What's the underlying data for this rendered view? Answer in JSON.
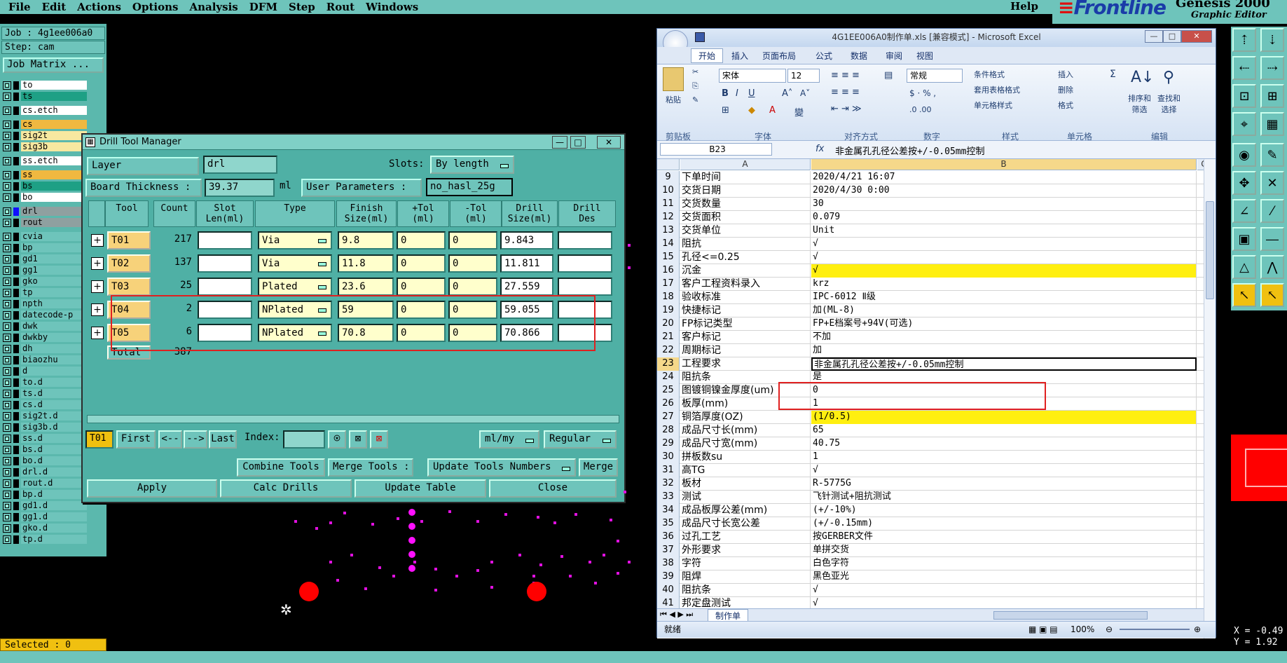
{
  "menu": [
    "File",
    "Edit",
    "Actions",
    "Options",
    "Analysis",
    "DFM",
    "Step",
    "Rout",
    "Windows"
  ],
  "menu_help": "Help",
  "brand": {
    "logo": "Frontline",
    "product": "Genesis 2000",
    "sub": "Graphic Editor"
  },
  "job_label": "Job : 4g1ee006a0",
  "step_label": "Step: cam",
  "job_matrix_label": "Job Matrix ...",
  "layers": [
    {
      "name": "to",
      "sel": false,
      "color": "#ffffff"
    },
    {
      "name": "ts",
      "sel": false,
      "color": "#1ea085"
    },
    {
      "name": "cs.etch",
      "sel": false,
      "color": "#ffffff"
    },
    {
      "name": "cs",
      "sel": false,
      "color": "#f0b840"
    },
    {
      "name": "sig2t",
      "sel": false,
      "color": "#f7e8a0"
    },
    {
      "name": "sig3b",
      "sel": false,
      "color": "#f7e8a0"
    },
    {
      "name": "ss.etch",
      "sel": false,
      "color": "#ffffff"
    },
    {
      "name": "ss",
      "sel": false,
      "color": "#f0b840"
    },
    {
      "name": "bs",
      "sel": false,
      "color": "#1ea085"
    },
    {
      "name": "bo",
      "sel": false,
      "color": "#ffffff"
    },
    {
      "name": "drl",
      "sel": true,
      "color": "#8fa0a0"
    },
    {
      "name": "rout",
      "sel": false,
      "color": "#8fa0a0"
    },
    {
      "name": "cvia",
      "sel": false,
      "color": "#6ec4bb"
    },
    {
      "name": "bp",
      "sel": false,
      "color": "#6ec4bb"
    },
    {
      "name": "gd1",
      "sel": false,
      "color": "#6ec4bb"
    },
    {
      "name": "gg1",
      "sel": false,
      "color": "#6ec4bb"
    },
    {
      "name": "gko",
      "sel": false,
      "color": "#6ec4bb"
    },
    {
      "name": "tp",
      "sel": false,
      "color": "#6ec4bb"
    },
    {
      "name": "npth",
      "sel": false,
      "color": "#6ec4bb"
    },
    {
      "name": "datecode-p",
      "sel": false,
      "color": "#6ec4bb"
    },
    {
      "name": "dwk",
      "sel": false,
      "color": "#6ec4bb"
    },
    {
      "name": "dwkby",
      "sel": false,
      "color": "#6ec4bb"
    },
    {
      "name": "dh",
      "sel": false,
      "color": "#6ec4bb"
    },
    {
      "name": "biaozhu",
      "sel": false,
      "color": "#6ec4bb"
    },
    {
      "name": "d",
      "sel": false,
      "color": "#6ec4bb"
    },
    {
      "name": "to.d",
      "sel": false,
      "color": "#6ec4bb"
    },
    {
      "name": "ts.d",
      "sel": false,
      "color": "#6ec4bb"
    },
    {
      "name": "cs.d",
      "sel": false,
      "color": "#6ec4bb"
    },
    {
      "name": "sig2t.d",
      "sel": false,
      "color": "#6ec4bb"
    },
    {
      "name": "sig3b.d",
      "sel": false,
      "color": "#6ec4bb"
    },
    {
      "name": "ss.d",
      "sel": false,
      "color": "#6ec4bb"
    },
    {
      "name": "bs.d",
      "sel": false,
      "color": "#6ec4bb"
    },
    {
      "name": "bo.d",
      "sel": false,
      "color": "#6ec4bb"
    },
    {
      "name": "drl.d",
      "sel": false,
      "color": "#6ec4bb"
    },
    {
      "name": "rout.d",
      "sel": false,
      "color": "#6ec4bb"
    },
    {
      "name": "bp.d",
      "sel": false,
      "color": "#6ec4bb"
    },
    {
      "name": "gd1.d",
      "sel": false,
      "color": "#6ec4bb"
    },
    {
      "name": "gg1.d",
      "sel": false,
      "color": "#6ec4bb"
    },
    {
      "name": "gko.d",
      "sel": false,
      "color": "#6ec4bb"
    },
    {
      "name": "tp.d",
      "sel": false,
      "color": "#6ec4bb"
    }
  ],
  "selected_label": "Selected : 0",
  "coords": {
    "x": "X = -0.49",
    "y": "Y = 1.92"
  },
  "dtm": {
    "title": "Drill Tool Manager",
    "layer_label": "Layer",
    "layer_colon": ":",
    "layer_value": "drl",
    "slots_label": "Slots:",
    "slots_value": "By length",
    "board_label": "Board Thickness :",
    "board_value": "39.37",
    "board_unit": "ml",
    "user_params_label": "User Parameters :",
    "user_params_value": "no_hasl_25g",
    "headers": [
      "Tool",
      "Count",
      "Slot\nLen(ml)",
      "Type",
      "Finish\nSize(ml)",
      "+Tol\n(ml)",
      "-Tol\n(ml)",
      "Drill\nSize(ml)",
      "Drill\nDes"
    ],
    "rows": [
      {
        "tool": "T01",
        "count": "217",
        "type": "Via",
        "finish": "9.8",
        "ptol": "0",
        "mtol": "0",
        "drill": "9.843"
      },
      {
        "tool": "T02",
        "count": "137",
        "type": "Via",
        "finish": "11.8",
        "ptol": "0",
        "mtol": "0",
        "drill": "11.811"
      },
      {
        "tool": "T03",
        "count": "25",
        "type": "Plated",
        "finish": "23.6",
        "ptol": "0",
        "mtol": "0",
        "drill": "27.559"
      },
      {
        "tool": "T04",
        "count": "2",
        "type": "NPlated",
        "finish": "59",
        "ptol": "0",
        "mtol": "0",
        "drill": "59.055"
      },
      {
        "tool": "T05",
        "count": "6",
        "type": "NPlated",
        "finish": "70.8",
        "ptol": "0",
        "mtol": "0",
        "drill": "70.866"
      }
    ],
    "total_label": "Total",
    "total_value": "387",
    "current_tool": "T01",
    "nav": {
      "first": "First",
      "prev": "<--",
      "next": "-->",
      "last": "Last",
      "index": "Index:"
    },
    "units": "ml/my",
    "mode": "Regular",
    "combine": "Combine Tools",
    "merge_tools": "Merge Tools :",
    "update_numbers": "Update Tools Numbers",
    "merge": "Merge",
    "apply": "Apply",
    "calc": "Calc Drills",
    "update_table": "Update Table",
    "close": "Close"
  },
  "excel": {
    "title": "4G1EE006A0制作单.xls [兼容模式] - Microsoft Excel",
    "tabs": [
      "开始",
      "插入",
      "页面布局",
      "公式",
      "数据",
      "审阅",
      "视图"
    ],
    "font_name": "宋体",
    "font_size": "12",
    "number_format": "常规",
    "groups": [
      "剪贴板",
      "字体",
      "对齐方式",
      "数字",
      "样式",
      "单元格",
      "编辑"
    ],
    "paste": "粘贴",
    "style_items": [
      "条件格式",
      "套用表格格式",
      "单元格样式"
    ],
    "cell_items": [
      "插入",
      "删除",
      "格式"
    ],
    "edit_items": [
      "排序和\n筛选",
      "查找和\n选择"
    ],
    "name_box": "B23",
    "fx": "fx",
    "formula": "非金属孔孔径公差按+/-0.05mm控制",
    "cols": [
      "A",
      "B",
      "C"
    ],
    "rows": [
      {
        "n": "9",
        "a": "下单时间",
        "b": "2020/4/21 16:07"
      },
      {
        "n": "10",
        "a": "交货日期",
        "b": "2020/4/30 0:00"
      },
      {
        "n": "11",
        "a": "交货数量",
        "b": "30"
      },
      {
        "n": "12",
        "a": "交货面积",
        "b": "0.079"
      },
      {
        "n": "13",
        "a": "交货单位",
        "b": "Unit"
      },
      {
        "n": "14",
        "a": "阻抗",
        "b": "√"
      },
      {
        "n": "15",
        "a": "孔径<=0.25",
        "b": "√"
      },
      {
        "n": "16",
        "a": "沉金",
        "b": "√",
        "hl": true
      },
      {
        "n": "17",
        "a": "客户工程资料录入",
        "b": "krz"
      },
      {
        "n": "18",
        "a": "验收标准",
        "b": "IPC-6012 Ⅱ级"
      },
      {
        "n": "19",
        "a": "快捷标记",
        "b": "加(ML-8)"
      },
      {
        "n": "20",
        "a": "FP标记类型",
        "b": "FP+E档案号+94V(可选)"
      },
      {
        "n": "21",
        "a": "客户标记",
        "b": "不加"
      },
      {
        "n": "22",
        "a": "周期标记",
        "b": "加"
      },
      {
        "n": "23",
        "a": "工程要求",
        "b": "非金属孔孔径公差按+/-0.05mm控制"
      },
      {
        "n": "24",
        "a": "阻抗条",
        "b": "是"
      },
      {
        "n": "25",
        "a": "图镀铜镍金厚度(um)",
        "b": "0"
      },
      {
        "n": "26",
        "a": "板厚(mm)",
        "b": "1"
      },
      {
        "n": "27",
        "a": "铜箔厚度(OZ)",
        "b": "(1/0.5)",
        "hl": true
      },
      {
        "n": "28",
        "a": "成品尺寸长(mm)",
        "b": "65"
      },
      {
        "n": "29",
        "a": "成品尺寸宽(mm)",
        "b": "40.75"
      },
      {
        "n": "30",
        "a": "拼板数su",
        "b": "1"
      },
      {
        "n": "31",
        "a": "高TG",
        "b": "√"
      },
      {
        "n": "32",
        "a": "板材",
        "b": "R-5775G"
      },
      {
        "n": "33",
        "a": "测试",
        "b": "飞针测试+阻抗测试"
      },
      {
        "n": "34",
        "a": "成品板厚公差(mm)",
        "b": "(+/-10%)"
      },
      {
        "n": "35",
        "a": "成品尺寸长宽公差",
        "b": "(+/-0.15mm)"
      },
      {
        "n": "36",
        "a": "过孔工艺",
        "b": "按GERBER文件"
      },
      {
        "n": "37",
        "a": "外形要求",
        "b": "单拼交货"
      },
      {
        "n": "38",
        "a": "字符",
        "b": "白色字符"
      },
      {
        "n": "39",
        "a": "阻焊",
        "b": "黑色亚光"
      },
      {
        "n": "40",
        "a": "阻抗条",
        "b": "√"
      },
      {
        "n": "41",
        "a": "邦定盘测试",
        "b": "√"
      }
    ],
    "sheet_tab": "制作单",
    "status": "就绪",
    "zoom": "100%"
  }
}
